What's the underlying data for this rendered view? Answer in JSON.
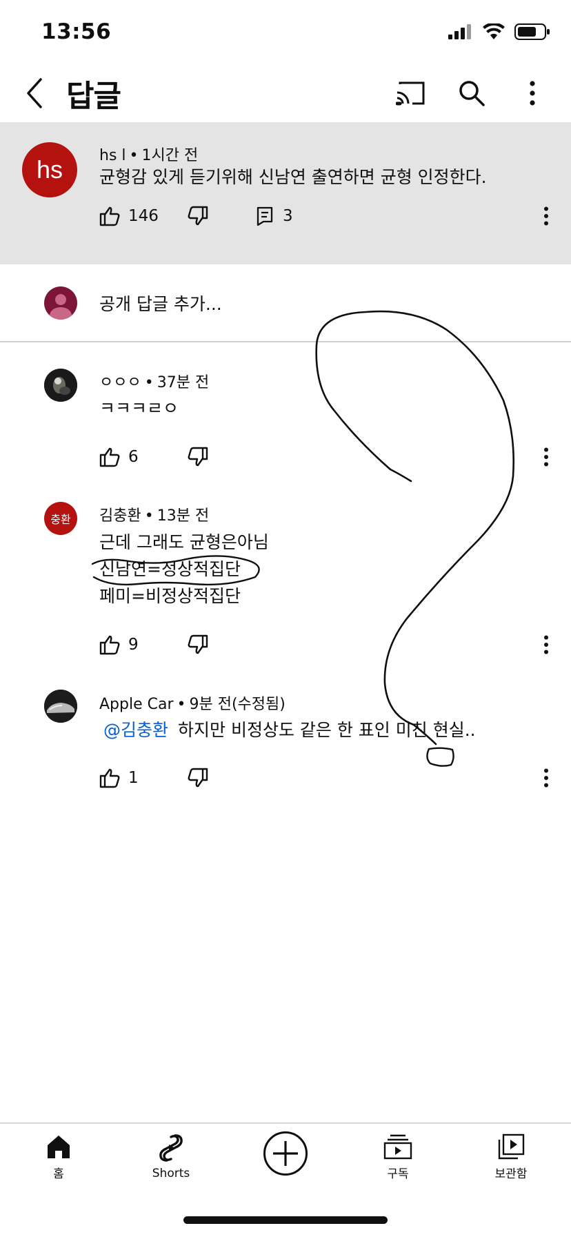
{
  "status_bar": {
    "time": "13:56"
  },
  "header": {
    "title": "답글"
  },
  "parent_comment": {
    "avatar_initials": "hs",
    "avatar_color": "#b3120f",
    "author": "hs l",
    "time": "1시간 전",
    "text": "균형감 있게 듣기위해 신남연 출연하면 균형 인정한다.",
    "likes": "146",
    "replies": "3"
  },
  "reply_input": {
    "placeholder": "공개 답글 추가..."
  },
  "replies": [
    {
      "author": "ㅇㅇㅇ",
      "time": "37분 전",
      "text_lines": [
        "ㅋㅋㅋㄹㅇ"
      ],
      "likes": "6"
    },
    {
      "author": "김충환",
      "time": "13분 전",
      "avatar_initials": "충환",
      "avatar_color": "#b3120f",
      "text_lines": [
        "근데 그래도 균형은아님",
        "신남연=정상적집단",
        "페미=비정상적집단"
      ],
      "likes": "9"
    },
    {
      "author": "Apple Car",
      "time": "9분 전(수정됨)",
      "mention": "@김충환",
      "text": "하지만 비정상도 같은 한 표인 미친 현실..",
      "likes": "1"
    }
  ],
  "bottom_nav": {
    "items": [
      {
        "label": "홈",
        "icon": "home-icon"
      },
      {
        "label": "Shorts",
        "icon": "shorts-icon"
      },
      {
        "label": "",
        "icon": "create-icon"
      },
      {
        "label": "구독",
        "icon": "subscriptions-icon"
      },
      {
        "label": "보관함",
        "icon": "library-icon"
      }
    ]
  },
  "colors": {
    "mention": "#065fd4",
    "avatar_red": "#b3120f",
    "highlight_bg": "#e4e4e4"
  }
}
